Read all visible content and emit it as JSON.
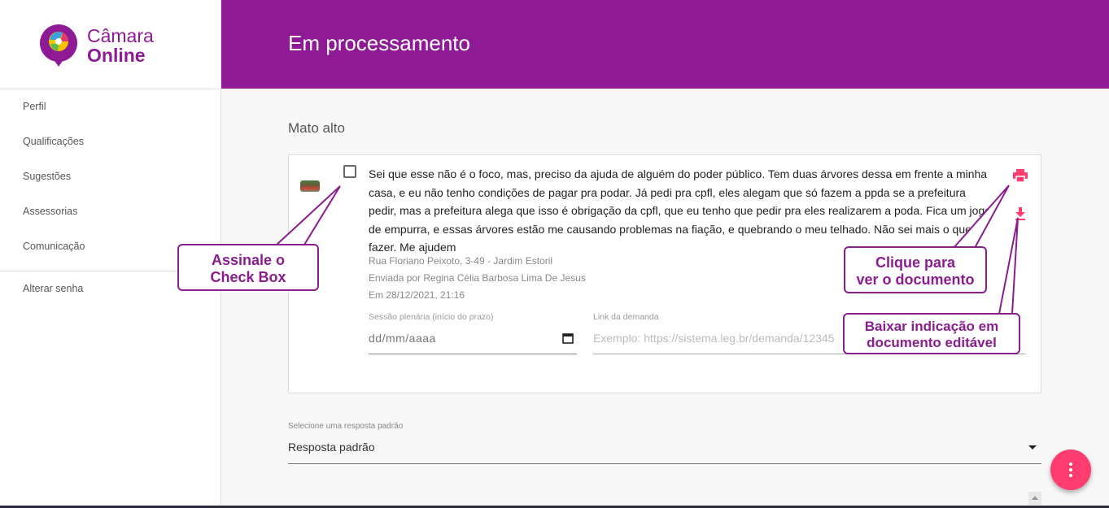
{
  "app": {
    "logo_line1": "Câmara",
    "logo_line2": "Online",
    "brand_color": "#8e1a96",
    "accent_color": "#ff3d6f"
  },
  "sidebar": {
    "items": [
      {
        "label": "Perfil"
      },
      {
        "label": "Qualificações"
      },
      {
        "label": "Sugestões"
      },
      {
        "label": "Assessorias"
      },
      {
        "label": "Comunicação"
      }
    ],
    "secondary": [
      {
        "label": "Alterar senha"
      }
    ]
  },
  "header": {
    "title": "Em processamento"
  },
  "main": {
    "section_title": "Mato alto",
    "card": {
      "message": "Sei que esse não é o foco, mas, preciso da ajuda de alguém do poder público. Tem duas árvores dessa em frente a minha casa, e eu não tenho condições de pagar pra podar. Já pedi pra cpfl, eles alegam que só fazem a ppda se a prefeitura pedir, mas a prefeitura alega que isso é obrigação da cpfl, que eu tenho que pedir pra eles realizarem a poda. Fica um jogo de empurra, e essas árvores estão me causando problemas na fiação, e quebrando o meu telhado. Não sei mais o que fazer. Me ajudem",
      "address": "Rua Floriano Peixoto, 3-49 - Jardim Estoril",
      "sent_by": "Enviada por Regina Célia Barbosa Lima De Jesus",
      "date": "Em 28/12/2021, 21:16",
      "session_label": "Sessão plenária (início do prazo)",
      "session_placeholder": "dd/mm/aaaa",
      "link_label": "Link da demanda",
      "link_placeholder": "Exemplo: https://sistema.leg.br/demanda/12345",
      "print_icon": "print-icon",
      "download_icon": "download-icon"
    },
    "select_label": "Selecione uma resposta padrão",
    "select_value": "Resposta padrão"
  },
  "callouts": {
    "checkbox": [
      "Assinale o",
      "Check Box"
    ],
    "print": [
      "Clique para",
      "ver o documento"
    ],
    "download": [
      "Baixar indicação em",
      "documento editável"
    ],
    "color": "#8a1d8e"
  }
}
